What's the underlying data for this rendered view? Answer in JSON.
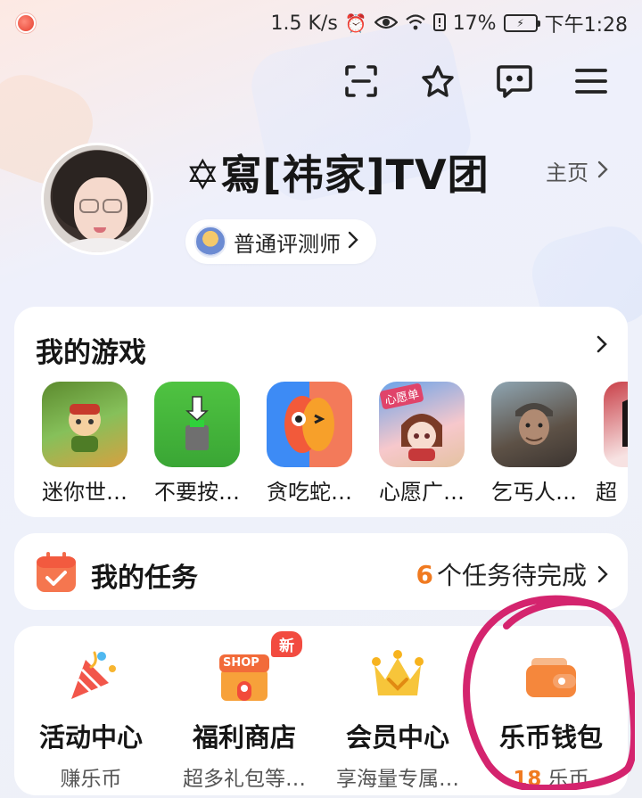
{
  "status_bar": {
    "speed": "1.5 K/s",
    "battery": "17%",
    "time": "下午1:28"
  },
  "top_actions": [
    "scan-icon",
    "star-badge-icon",
    "message-icon",
    "menu-icon"
  ],
  "profile": {
    "username": "✡寫[祎家]TV团",
    "homepage_label": "主页",
    "title_badge": "普通评测师"
  },
  "my_games": {
    "title": "我的游戏",
    "games": [
      {
        "name": "迷你世…"
      },
      {
        "name": "不要按…"
      },
      {
        "name": "贪吃蛇…"
      },
      {
        "name": "心愿广…",
        "thumb_text": "心愿单"
      },
      {
        "name": "乞丐人…"
      },
      {
        "name": "超"
      }
    ]
  },
  "my_tasks": {
    "title": "我的任务",
    "count": "6",
    "status_suffix": "个任务待完成"
  },
  "quick_links": [
    {
      "label": "活动中心",
      "sub": "赚乐币"
    },
    {
      "label": "福利商店",
      "sub": "超多礼包等…",
      "badge": "新",
      "icon_text": "SHOP"
    },
    {
      "label": "会员中心",
      "sub": "享海量专属…"
    },
    {
      "label": "乐币钱包",
      "coin": "18",
      "coin_unit": "乐币"
    }
  ],
  "colors": {
    "accent_orange": "#f07a20",
    "badge_red": "#f24b40",
    "annotation_magenta": "#d4246e"
  }
}
